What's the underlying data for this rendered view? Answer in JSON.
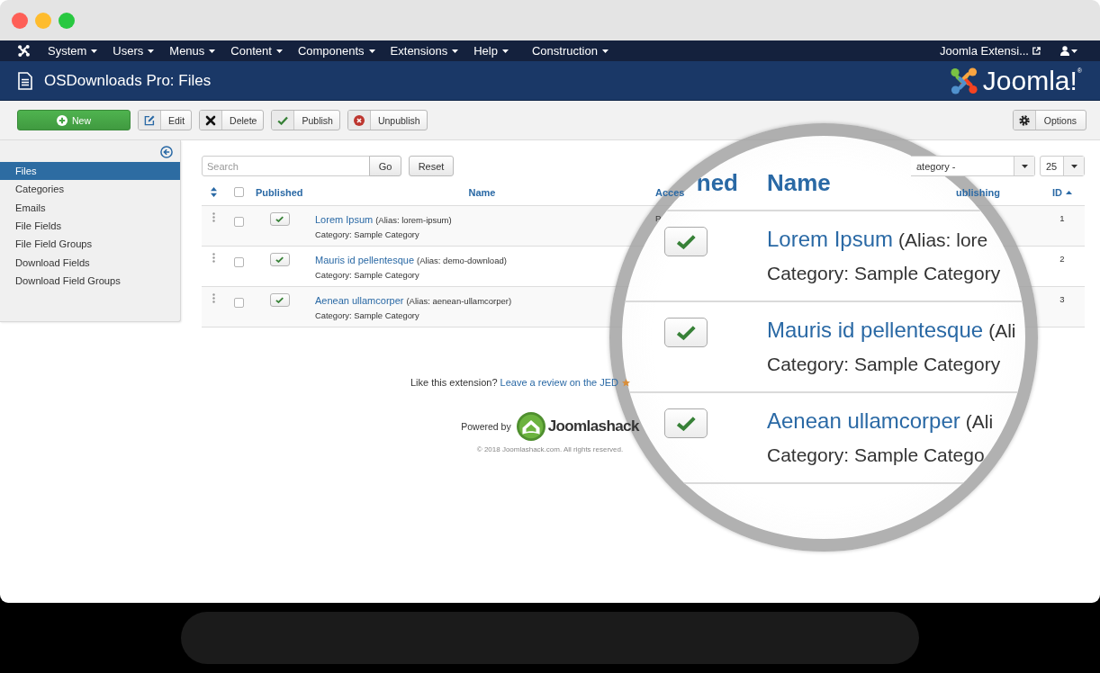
{
  "window": {
    "controls": [
      {
        "color": "#fe5f57"
      },
      {
        "color": "#febc2e"
      },
      {
        "color": "#28c840"
      }
    ]
  },
  "navbar": {
    "menus": [
      {
        "label": "System"
      },
      {
        "label": "Users"
      },
      {
        "label": "Menus"
      },
      {
        "label": "Content"
      },
      {
        "label": "Components"
      },
      {
        "label": "Extensions"
      },
      {
        "label": "Help"
      }
    ],
    "custom_menus": [
      {
        "label": "Construction"
      }
    ],
    "site_link": {
      "label": "Joomla Extensi..."
    }
  },
  "header": {
    "title": "OSDownloads Pro: Files",
    "logo_text": "Joomla!$^{®}$"
  },
  "toolbar": {
    "buttons": [
      {
        "kind": "new",
        "label": "New"
      },
      {
        "kind": "edit",
        "label": "Edit"
      },
      {
        "kind": "delete",
        "label": "Delete"
      },
      {
        "kind": "publish",
        "label": "Publish"
      },
      {
        "kind": "unpublish",
        "label": "Unpublish"
      }
    ],
    "options_button": {
      "label": "Options"
    }
  },
  "sidebar": {
    "items": [
      {
        "label": "Files",
        "selected": true
      },
      {
        "label": "Categories",
        "selected": false
      },
      {
        "label": "Emails",
        "selected": false
      },
      {
        "label": "File Fields",
        "selected": false
      },
      {
        "label": "File Field Groups",
        "selected": false
      },
      {
        "label": "Download Fields",
        "selected": false
      },
      {
        "label": "Download Field Groups",
        "selected": false
      }
    ]
  },
  "filters": {
    "search": {
      "placeholder": "Search"
    },
    "go_button": {
      "label": "Go"
    },
    "reset_button": {
      "label": "Reset"
    },
    "category_select": {
      "value": "ategory -"
    },
    "limit_select": {
      "value": "25"
    }
  },
  "table": {
    "select_all": {
      "checked": false
    },
    "columns": [
      {
        "label": "Published",
        "sorted": false
      },
      {
        "label": "Name",
        "sorted": false
      },
      {
        "label": "Acces",
        "sorted": false
      },
      {
        "label": "ublishing",
        "sorted": false
      },
      {
        "label": "ID",
        "sorted": true
      }
    ],
    "rows": [
      {
        "checked": false,
        "published": true,
        "name": "Lorem Ipsum",
        "alias": "(Alias: lorem-ipsum)",
        "category": "Category: Sample Category",
        "access": "P",
        "id": "1"
      },
      {
        "checked": false,
        "published": true,
        "name": "Mauris id pellentesque",
        "alias": "(Alias: demo-download)",
        "category": "Category: Sample Category",
        "id": "2"
      },
      {
        "checked": false,
        "published": true,
        "name": "Aenean ullamcorper",
        "alias": "(Alias: aenean-ullamcorper)",
        "category": "Category: Sample Category",
        "id": "3"
      }
    ]
  },
  "magnifier": {
    "columns": [
      {
        "label": "ned"
      },
      {
        "label": "Name"
      }
    ],
    "rows": [
      {
        "published": true,
        "name": "Lorem Ipsum",
        "alias": "(Alias: lore",
        "category": "Category: Sample Category"
      },
      {
        "published": true,
        "name": "Mauris id pellentesque",
        "alias": "(Ali",
        "category": "Category: Sample Category"
      },
      {
        "published": true,
        "name": "Aenean ullamcorper",
        "alias": "(Ali",
        "category": "Category: Sample Catego"
      }
    ]
  },
  "footer": {
    "prompt": "Like this extension?",
    "review_link": "Leave a review on the JED",
    "powered_by": "Powered by",
    "brand": "Joomlashack",
    "copyright": "© 2018 Joomlashack.com. All rights reserved."
  }
}
